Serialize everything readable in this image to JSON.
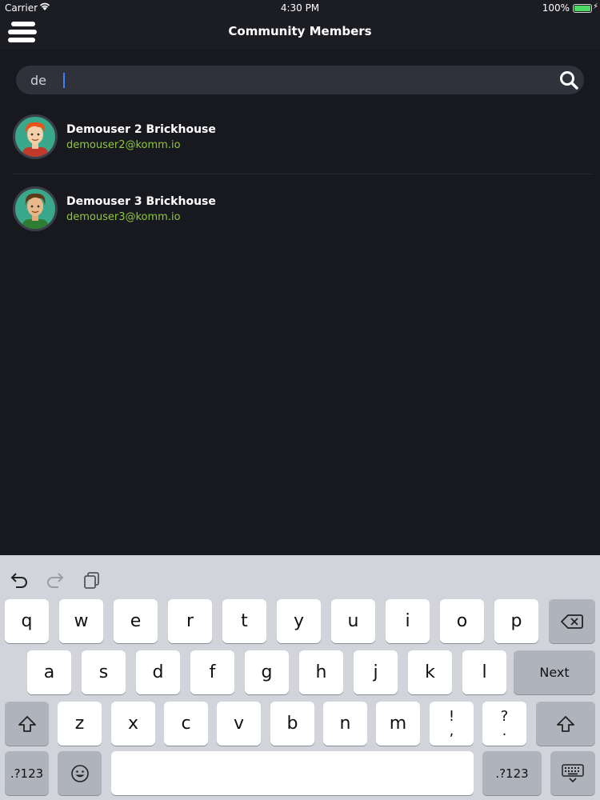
{
  "status_bar": {
    "carrier": "Carrier",
    "time": "4:30 PM",
    "battery": "100%"
  },
  "nav": {
    "title": "Community Members"
  },
  "search": {
    "value": "de"
  },
  "members": [
    {
      "name": "Demouser 2 Brickhouse",
      "email": "demouser2@komm.io"
    },
    {
      "name": "Demouser 3 Brickhouse",
      "email": "demouser3@komm.io"
    }
  ],
  "keyboard": {
    "row1": [
      "q",
      "w",
      "e",
      "r",
      "t",
      "y",
      "u",
      "i",
      "o",
      "p"
    ],
    "row2": [
      "a",
      "s",
      "d",
      "f",
      "g",
      "h",
      "j",
      "k",
      "l"
    ],
    "row3": [
      "z",
      "x",
      "c",
      "v",
      "b",
      "n",
      "m"
    ],
    "punct1": [
      "!",
      ","
    ],
    "punct2": [
      "?",
      "."
    ],
    "next_label": "Next",
    "numbers_label": ".?123"
  },
  "colors": {
    "background": "#18191e",
    "email_green": "#8ec63f",
    "search_bg": "#30323b"
  }
}
